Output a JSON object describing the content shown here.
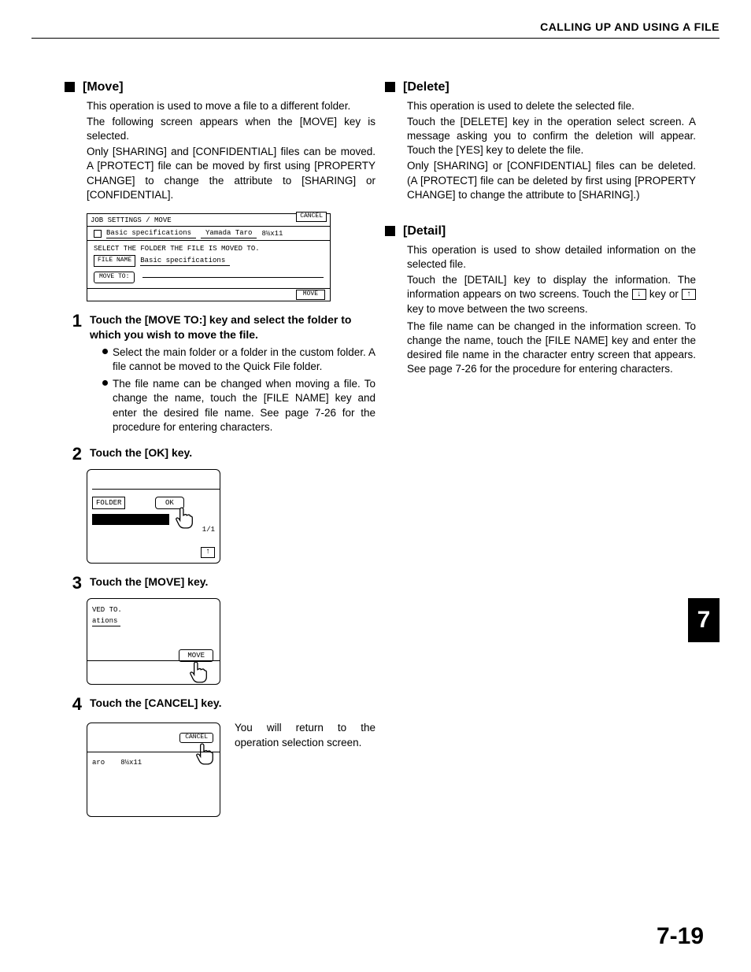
{
  "header": {
    "title": "CALLING UP AND USING A FILE"
  },
  "chapter": {
    "tab": "7",
    "page_number": "7-19"
  },
  "move": {
    "heading": "[Move]",
    "p1": "This operation is used to move a file to a different folder.",
    "p2": "The following screen appears when the  [MOVE] key is selected.",
    "p3": "Only [SHARING] and [CONFIDENTIAL] files can be moved. A [PROTECT] file can be moved by first using [PROPERTY CHANGE] to change the attribute to [SHARING] or [CONFIDENTIAL].",
    "dialog": {
      "title": "JOB SETTINGS / MOVE",
      "cancel": "CANCEL",
      "file_row": {
        "name": "Basic specifications",
        "user": "Yamada Taro",
        "size": "8½x11"
      },
      "instruction": "SELECT THE FOLDER THE FILE IS MOVED TO.",
      "filename_label": "FILE NAME",
      "filename_value": "Basic specifications",
      "move_to": "MOVE TO:",
      "move_btn": "MOVE"
    },
    "steps": {
      "s1": {
        "num": "1",
        "title": "Touch the [MOVE TO:] key and select the folder to which you wish to move the file.",
        "b1": "Select the main folder or a folder in the custom folder. A file cannot be moved to the Quick File folder.",
        "b2": "The file name can be changed when moving a file. To change the name, touch the [FILE NAME] key and enter the desired file name. See page 7-26 for the procedure for entering characters."
      },
      "s2": {
        "num": "2",
        "title": "Touch the [OK] key.",
        "fig": {
          "folder": "FOLDER",
          "ok": "OK",
          "pages": "1/1",
          "arrow": "↑"
        }
      },
      "s3": {
        "num": "3",
        "title": "Touch the [MOVE] key.",
        "fig": {
          "t1": "VED TO.",
          "t2": "ations",
          "move": "MOVE"
        }
      },
      "s4": {
        "num": "4",
        "title": "Touch the [CANCEL] key.",
        "fig": {
          "cancel": "CANCEL",
          "c1": "aro",
          "c2": "8½x11"
        },
        "side": "You will return to the operation selection screen."
      }
    }
  },
  "delete": {
    "heading": "[Delete]",
    "p1": "This operation is used to delete the selected file.",
    "p2": "Touch the [DELETE] key in the operation select screen. A message asking you to confirm the deletion will appear. Touch the [YES] key to delete the file.",
    "p3": "Only [SHARING] or [CONFIDENTIAL] files can be deleted. (A [PROTECT] file can be deleted by first using [PROPERTY CHANGE] to change the attribute to [SHARING].)"
  },
  "detail": {
    "heading": "[Detail]",
    "p1": "This operation is used to show detailed information on the selected file.",
    "p2a": "Touch the [DETAIL] key to display the information. The information appears on two screens. Touch the ",
    "p2b": " key or ",
    "p2c": " key to move between the two screens.",
    "arrow_down": "↓",
    "arrow_up": "↑",
    "p3": "The file name can be changed in the information screen. To change the name, touch the [FILE NAME] key and enter the desired file name in the character entry screen that appears. See page 7-26 for the procedure for entering characters."
  }
}
